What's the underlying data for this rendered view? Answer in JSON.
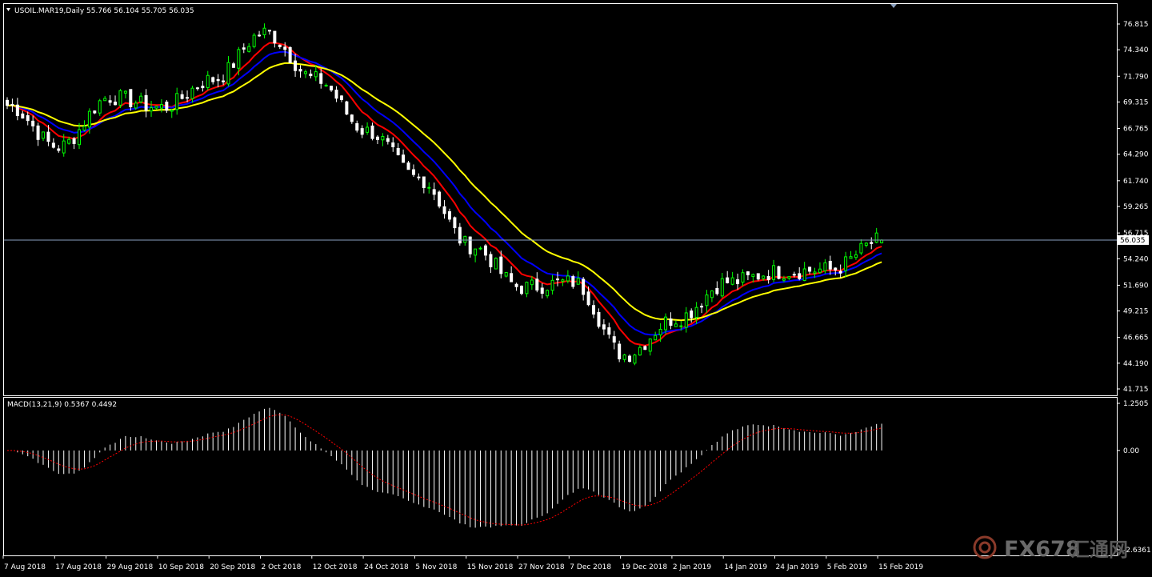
{
  "header": {
    "symbol_line": "USOIL.MAR19,Daily  55.766 56.104 55.705 56.035",
    "macd_line": "MACD(13,21,9) 0.5367 0.4492"
  },
  "colors": {
    "bull_candle": "#00ff00",
    "bear_candle": "#ffffff",
    "ma_fast": "#ff0000",
    "ma_mid": "#0000ff",
    "ma_slow": "#ffff00",
    "macd_hist": "#ffffff",
    "macd_signal": "#ff0000",
    "price_line": "#8aa0c0"
  },
  "price_axis": {
    "ticks": [
      "76.815",
      "74.340",
      "71.790",
      "69.315",
      "66.765",
      "64.290",
      "61.740",
      "59.265",
      "56.715",
      "54.240",
      "51.690",
      "49.215",
      "46.665",
      "44.190",
      "41.715"
    ],
    "current_price": "56.035"
  },
  "macd_axis": {
    "ticks": [
      "1.2505",
      "0.00",
      "-2.6361"
    ]
  },
  "time_axis": {
    "labels": [
      "7 Aug 2018",
      "17 Aug 2018",
      "29 Aug 2018",
      "10 Sep 2018",
      "20 Sep 2018",
      "2 Oct 2018",
      "12 Oct 2018",
      "24 Oct 2018",
      "5 Nov 2018",
      "15 Nov 2018",
      "27 Nov 2018",
      "7 Dec 2018",
      "19 Dec 2018",
      "2 Jan 2019",
      "14 Jan 2019",
      "24 Jan 2019",
      "5 Feb 2019",
      "15 Feb 2019"
    ]
  },
  "watermark": {
    "text_latin": "FX678",
    "text_cjk": "汇通网"
  },
  "chart_data": {
    "type": "candlestick",
    "symbol": "USOIL.MAR19",
    "timeframe": "Daily",
    "last_bar": {
      "open": 55.766,
      "high": 56.104,
      "low": 55.705,
      "close": 56.035
    },
    "ylim": [
      41.715,
      76.815
    ],
    "x_range": [
      "7 Aug 2018",
      "15 Feb 2019"
    ],
    "close_path": [
      {
        "date": "7 Aug 2018",
        "close": 69.0
      },
      {
        "date": "17 Aug 2018",
        "close": 65.0
      },
      {
        "date": "29 Aug 2018",
        "close": 69.8
      },
      {
        "date": "10 Sep 2018",
        "close": 68.8
      },
      {
        "date": "20 Sep 2018",
        "close": 71.5
      },
      {
        "date": "2 Oct 2018",
        "close": 76.0
      },
      {
        "date": "12 Oct 2018",
        "close": 71.5
      },
      {
        "date": "24 Oct 2018",
        "close": 66.5
      },
      {
        "date": "5 Nov 2018",
        "close": 62.0
      },
      {
        "date": "15 Nov 2018",
        "close": 55.5
      },
      {
        "date": "27 Nov 2018",
        "close": 51.5
      },
      {
        "date": "7 Dec 2018",
        "close": 52.0
      },
      {
        "date": "19 Dec 2018",
        "close": 45.0
      },
      {
        "date": "2 Jan 2019",
        "close": 48.5
      },
      {
        "date": "14 Jan 2019",
        "close": 52.0
      },
      {
        "date": "24 Jan 2019",
        "close": 53.0
      },
      {
        "date": "5 Feb 2019",
        "close": 53.2
      },
      {
        "date": "15 Feb 2019",
        "close": 56.035
      }
    ],
    "macd": {
      "name": "MACD(13,21,9)",
      "main": 0.5367,
      "signal": 0.4492,
      "ylim": [
        -2.6361,
        1.2505
      ]
    }
  }
}
